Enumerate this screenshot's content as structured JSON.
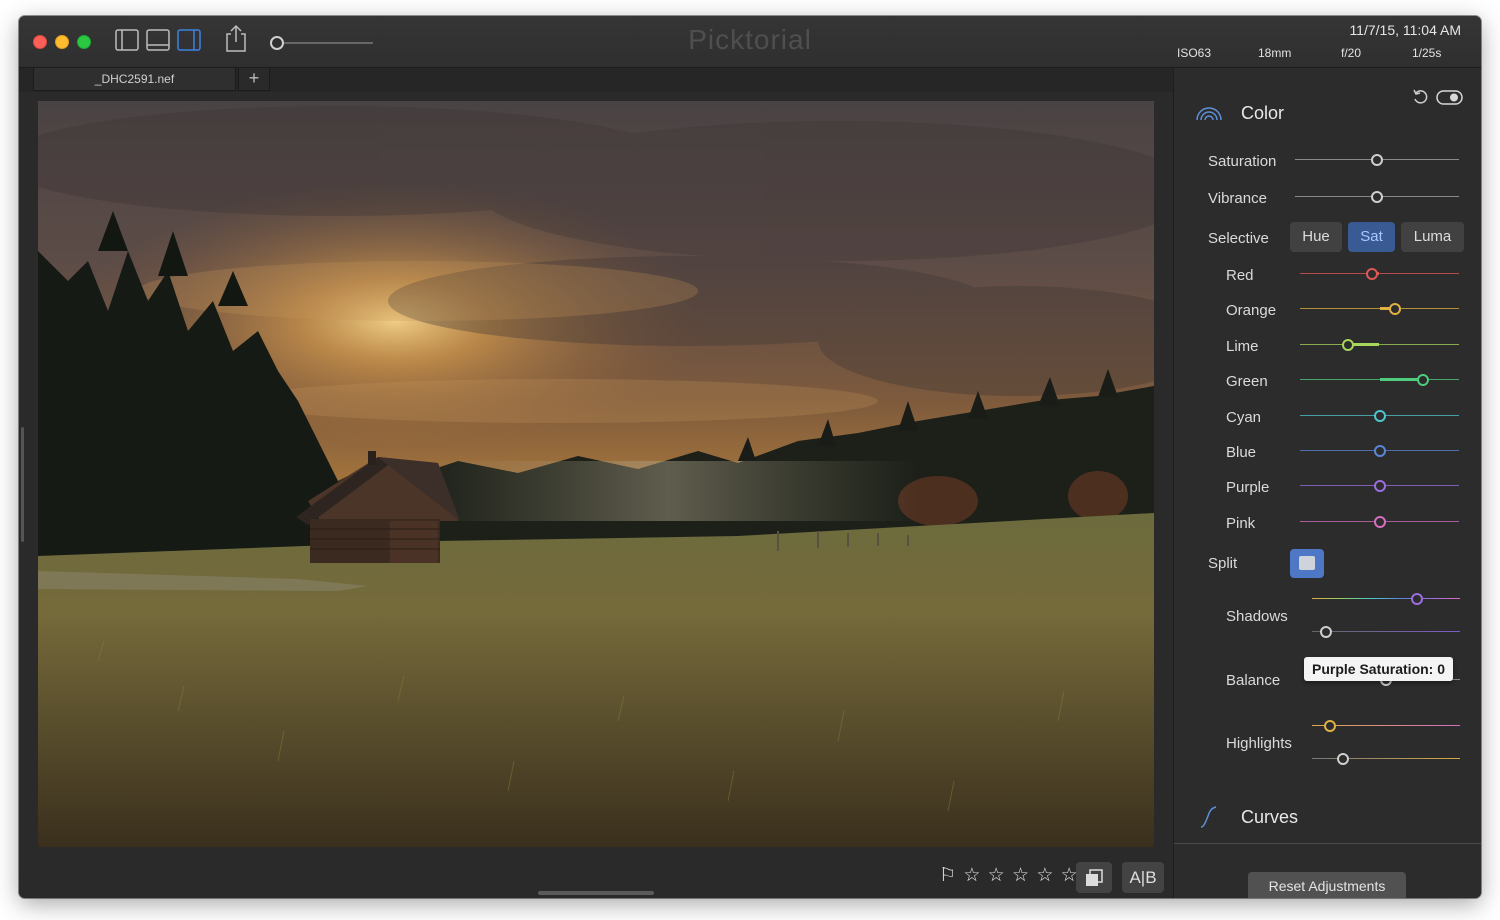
{
  "window": {
    "app_title": "Picktorial",
    "date_time": "11/7/15, 11:04 AM",
    "exif": {
      "iso": "ISO63",
      "focal_length": "18mm",
      "aperture": "f/20",
      "shutter": "1/25s"
    },
    "toolbar": {
      "icons": [
        "left-sidebar-icon",
        "bottom-panel-icon",
        "right-sidebar-icon",
        "share-icon"
      ],
      "zoom_level": 0
    }
  },
  "tabs": {
    "file_name": "_DHC2591.nef",
    "add_label": "+"
  },
  "photo": {
    "subject": "wooden cabin in a meadow at sunset with forest"
  },
  "bottom_bar": {
    "flag": "⚐",
    "stars": [
      "☆",
      "☆",
      "☆",
      "☆",
      "☆"
    ],
    "ab_label": "A|B"
  },
  "panel": {
    "color_section": {
      "title": "Color",
      "saturation_label": "Saturation",
      "saturation_value": 0,
      "vibrance_label": "Vibrance",
      "vibrance_value": 0,
      "selective_label": "Selective",
      "modes": [
        "Hue",
        "Sat",
        "Luma"
      ],
      "active_mode": "Sat",
      "channels": [
        {
          "label": "Red",
          "value": -0.1,
          "color": "#e05757"
        },
        {
          "label": "Orange",
          "value": 0.2,
          "color": "#e0b040"
        },
        {
          "label": "Lime",
          "value": -0.4,
          "color": "#a6d65a"
        },
        {
          "label": "Green",
          "value": 0.55,
          "color": "#4fcc7d"
        },
        {
          "label": "Cyan",
          "value": 0,
          "color": "#4fc6cc"
        },
        {
          "label": "Blue",
          "value": 0,
          "color": "#5b86d6"
        },
        {
          "label": "Purple",
          "value": 0,
          "color": "#9a6ee0"
        },
        {
          "label": "Pink",
          "value": 0,
          "color": "#d46ec0"
        }
      ],
      "split_label": "Split",
      "shadows_label": "Shadows",
      "balance_label": "Balance",
      "highlights_label": "Highlights",
      "tooltip": "Purple Saturation: 0"
    },
    "curves_section": {
      "title": "Curves"
    },
    "reset_label": "Reset Adjustments"
  }
}
